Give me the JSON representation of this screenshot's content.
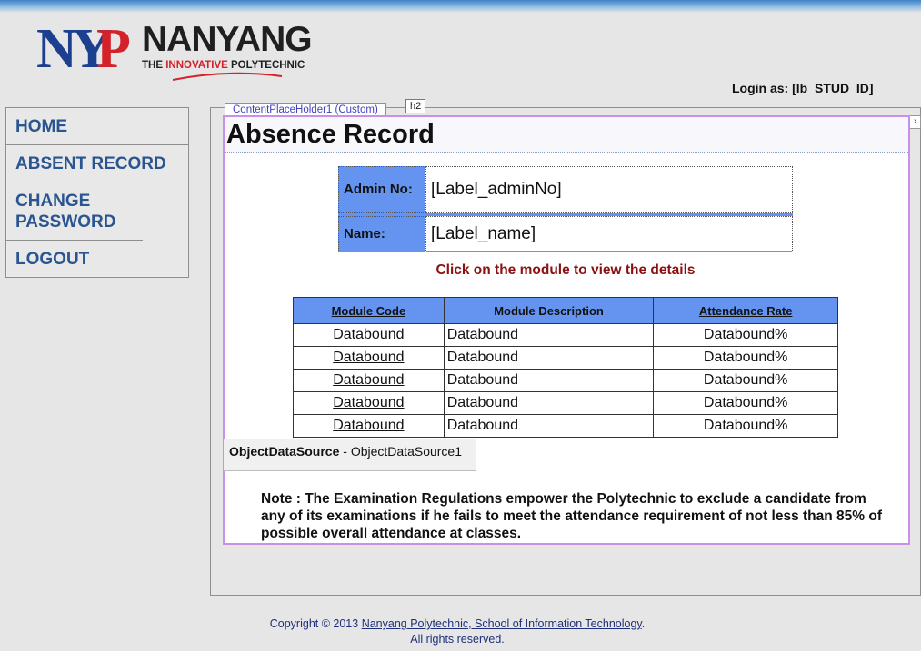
{
  "logo": {
    "mark": "NYP",
    "name": "NANYANG",
    "tagline_pre": "THE ",
    "tagline_hl": "INNOVATIVE",
    "tagline_post": " POLYTECHNIC"
  },
  "login_text": "Login as: [lb_STUD_ID]",
  "menu": [
    {
      "label": "HOME"
    },
    {
      "label": "ABSENT RECORD"
    },
    {
      "label": "CHANGE PASSWORD"
    },
    {
      "label": "LOGOUT"
    }
  ],
  "designer": {
    "cph_tab": "ContentPlaceHolder1 (Custom)",
    "h2_tag": "h2",
    "scroll_glyph": "›"
  },
  "page_title": "Absence Record",
  "info": {
    "admin_label": "Admin No:",
    "admin_value": "[Label_adminNo]",
    "name_label": "Name:",
    "name_value": "[Label_name]"
  },
  "hint": "Click on the module to view the details",
  "grid": {
    "headers": [
      "Module Code",
      "Module Description",
      "Attendance Rate"
    ],
    "rows": [
      [
        "Databound",
        "Databound",
        "Databound%"
      ],
      [
        "Databound",
        "Databound",
        "Databound%"
      ],
      [
        "Databound",
        "Databound",
        "Databound%"
      ],
      [
        "Databound",
        "Databound",
        "Databound%"
      ],
      [
        "Databound",
        "Databound",
        "Databound%"
      ]
    ]
  },
  "ods": {
    "type": "ObjectDataSource",
    "sep": " - ",
    "id": "ObjectDataSource1"
  },
  "note": "Note : The Examination Regulations empower the Polytechnic to exclude a candidate from any of its examinations if he fails to meet the attendance requirement of not less than 85% of possible overall attendance at classes.",
  "footer": {
    "pre": "Copyright © 2013 ",
    "link": "Nanyang Polytechnic, School of Information Technology",
    "post": ".",
    "line2": "All rights reserved."
  },
  "colors": {
    "header_blue": "#6494f0",
    "menu_text": "#2a5590",
    "hint_red": "#8b1010",
    "brand_red": "#d3222a",
    "brand_navy": "#1d3f8f"
  }
}
